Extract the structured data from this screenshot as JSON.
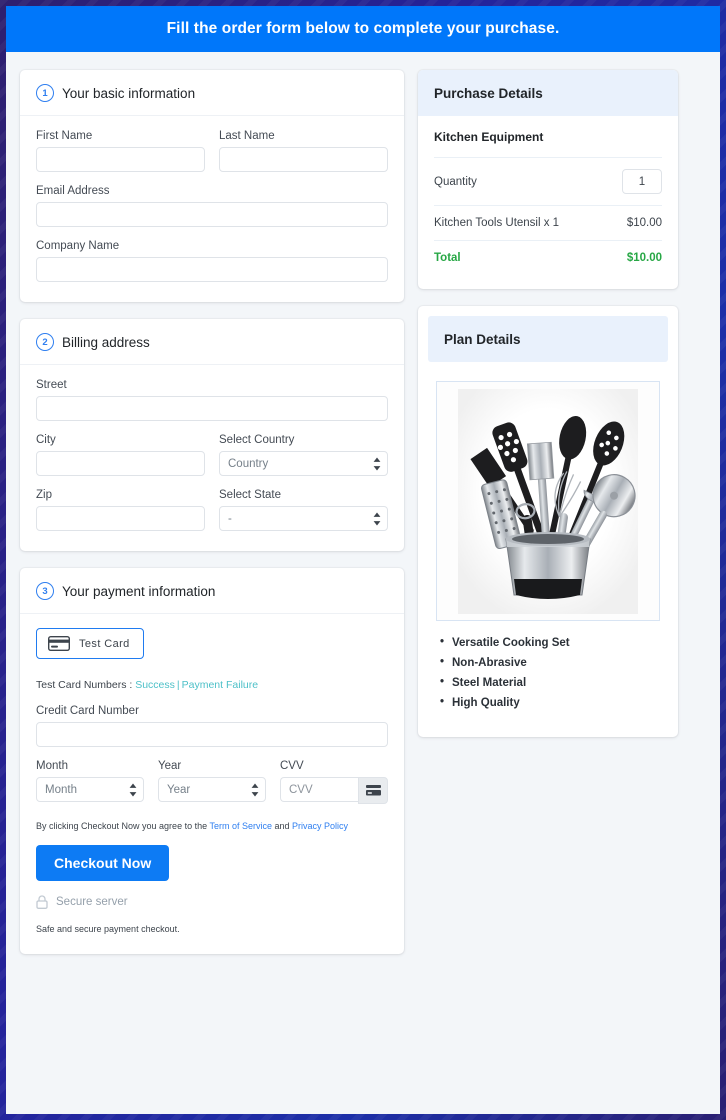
{
  "banner": {
    "text": "Fill the order form below to complete your purchase."
  },
  "colors": {
    "banner_blue": "#0077fa",
    "accent_blue": "#2f7ff0",
    "button_blue": "#0d7bf4",
    "total_green": "#27a745",
    "link_teal": "#4dc0c8",
    "panel_header_bg": "#e9f1fc",
    "page_bg": "#f3f6f9",
    "outer_bg": "#1f2a9e"
  },
  "sections": {
    "basic": {
      "step": "1",
      "title": "Your basic information",
      "first_name_label": "First Name",
      "first_name_value": "",
      "last_name_label": "Last Name",
      "last_name_value": "",
      "email_label": "Email Address",
      "email_value": "",
      "company_label": "Company Name",
      "company_value": ""
    },
    "billing": {
      "step": "2",
      "title": "Billing address",
      "street_label": "Street",
      "street_value": "",
      "city_label": "City",
      "city_value": "",
      "country_label": "Select Country",
      "country_value": "Country",
      "zip_label": "Zip",
      "zip_value": "",
      "state_label": "Select State",
      "state_value": "-"
    },
    "payment": {
      "step": "3",
      "title": "Your payment information",
      "tab_label": "Test  Card",
      "test_cards_prefix": "Test Card Numbers : ",
      "test_cards_success": "Success",
      "test_cards_separator": "|",
      "test_cards_failure": "Payment Failure",
      "card_number_label": "Credit Card Number",
      "card_number_value": "",
      "month_label": "Month",
      "month_value": "Month",
      "year_label": "Year",
      "year_value": "Year",
      "cvv_label": "CVV",
      "cvv_placeholder": "CVV",
      "cvv_value": "",
      "terms_prefix": "By clicking Checkout Now you agree to the ",
      "terms_link": "Term of Service",
      "terms_mid": " and ",
      "privacy_link": "Privacy Policy",
      "checkout_label": "Checkout Now",
      "secure_label": "Secure server",
      "safe_note": "Safe and secure payment checkout."
    }
  },
  "purchase": {
    "title": "Purchase Details",
    "product": "Kitchen Equipment",
    "quantity_label": "Quantity",
    "quantity_value": "1",
    "line_item_label": "Kitchen Tools Utensil x 1",
    "line_item_price": "$10.00",
    "total_label": "Total",
    "total_price": "$10.00"
  },
  "plan": {
    "title": "Plan Details",
    "image_alt": "kitchen-utensil-set",
    "features": [
      "Versatile Cooking Set",
      "Non-Abrasive",
      "Steel Material",
      " High Quality"
    ]
  }
}
